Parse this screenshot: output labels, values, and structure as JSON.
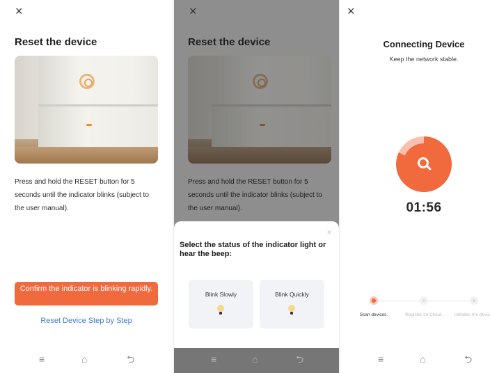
{
  "screen1": {
    "close_icon": "×",
    "title": "Reset the device",
    "description": "Press and hold the RESET button for 5 seconds until the indicator blinks (subject to the user manual).",
    "confirm_button": "Confirm the indicator is blinking rapidly.",
    "step_link": "Reset Device Step by Step"
  },
  "screen2": {
    "close_icon": "×",
    "title": "Reset the device",
    "description": "Press and hold the RESET button for 5 seconds until the indicator blinks (subject to the user manual).",
    "sheet": {
      "close_icon": "×",
      "title": "Select the status of the indicator light or hear the beep:",
      "options": [
        "Blink Slowly",
        "Blink Quickly"
      ]
    }
  },
  "screen3": {
    "close_icon": "×",
    "title": "Connecting Device",
    "subtitle": "Keep the network stable.",
    "timer": "01:56",
    "progress_fraction": 0.82,
    "steps": [
      {
        "label": "Scan devices.",
        "state": "active"
      },
      {
        "label": "Register on Cloud.",
        "state": "idle"
      },
      {
        "label": "Initialize the device.",
        "state": "idle"
      }
    ]
  },
  "navbar": {
    "menu_icon": "≡",
    "home_icon": "⌂",
    "back_icon": "⮌"
  },
  "colors": {
    "accent": "#f06a3e",
    "link": "#3f7bd1",
    "dim_overlay": "#8e8e8e"
  },
  "icons": [
    "close-icon",
    "search-icon",
    "menu-icon",
    "home-icon",
    "back-icon",
    "bulb-icon"
  ]
}
